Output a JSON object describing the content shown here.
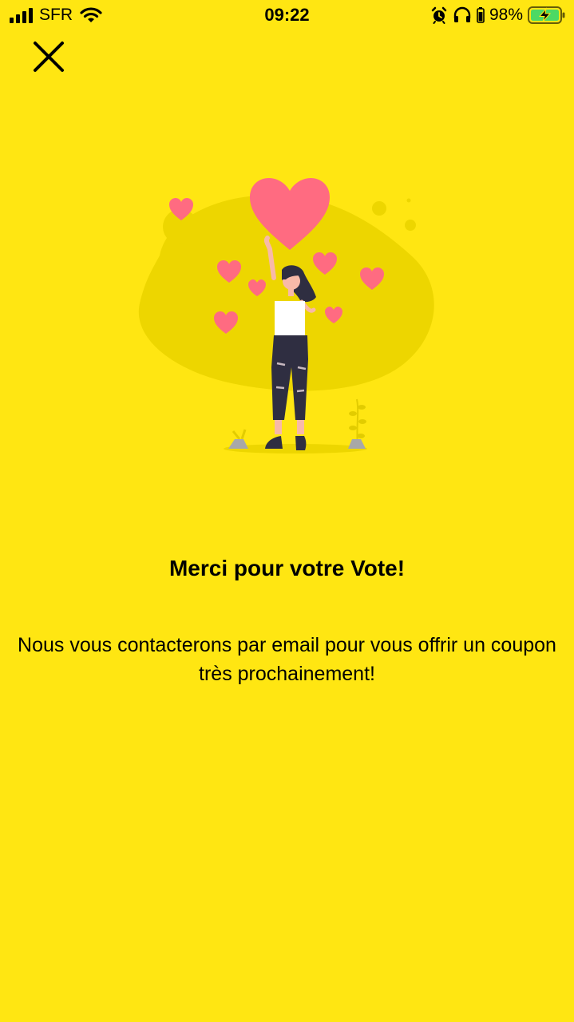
{
  "status_bar": {
    "carrier": "SFR",
    "time": "09:22",
    "battery_percent": "98%",
    "icons": [
      "signal-icon",
      "wifi-icon",
      "alarm-icon",
      "headphones-icon",
      "battery-charging-icon"
    ]
  },
  "close_button": {
    "icon": "close-icon"
  },
  "illustration": {
    "icon": "woman-with-hearts-illustration",
    "heart_color": "#FF6B81",
    "blob_color": "#EDD600"
  },
  "main": {
    "title": "Merci pour votre Vote!",
    "message": "Nous vous contacterons par email pour vous offrir un coupon très prochainement!"
  },
  "colors": {
    "background": "#FFE612",
    "text": "#000000",
    "battery_fill": "#4CD964"
  }
}
